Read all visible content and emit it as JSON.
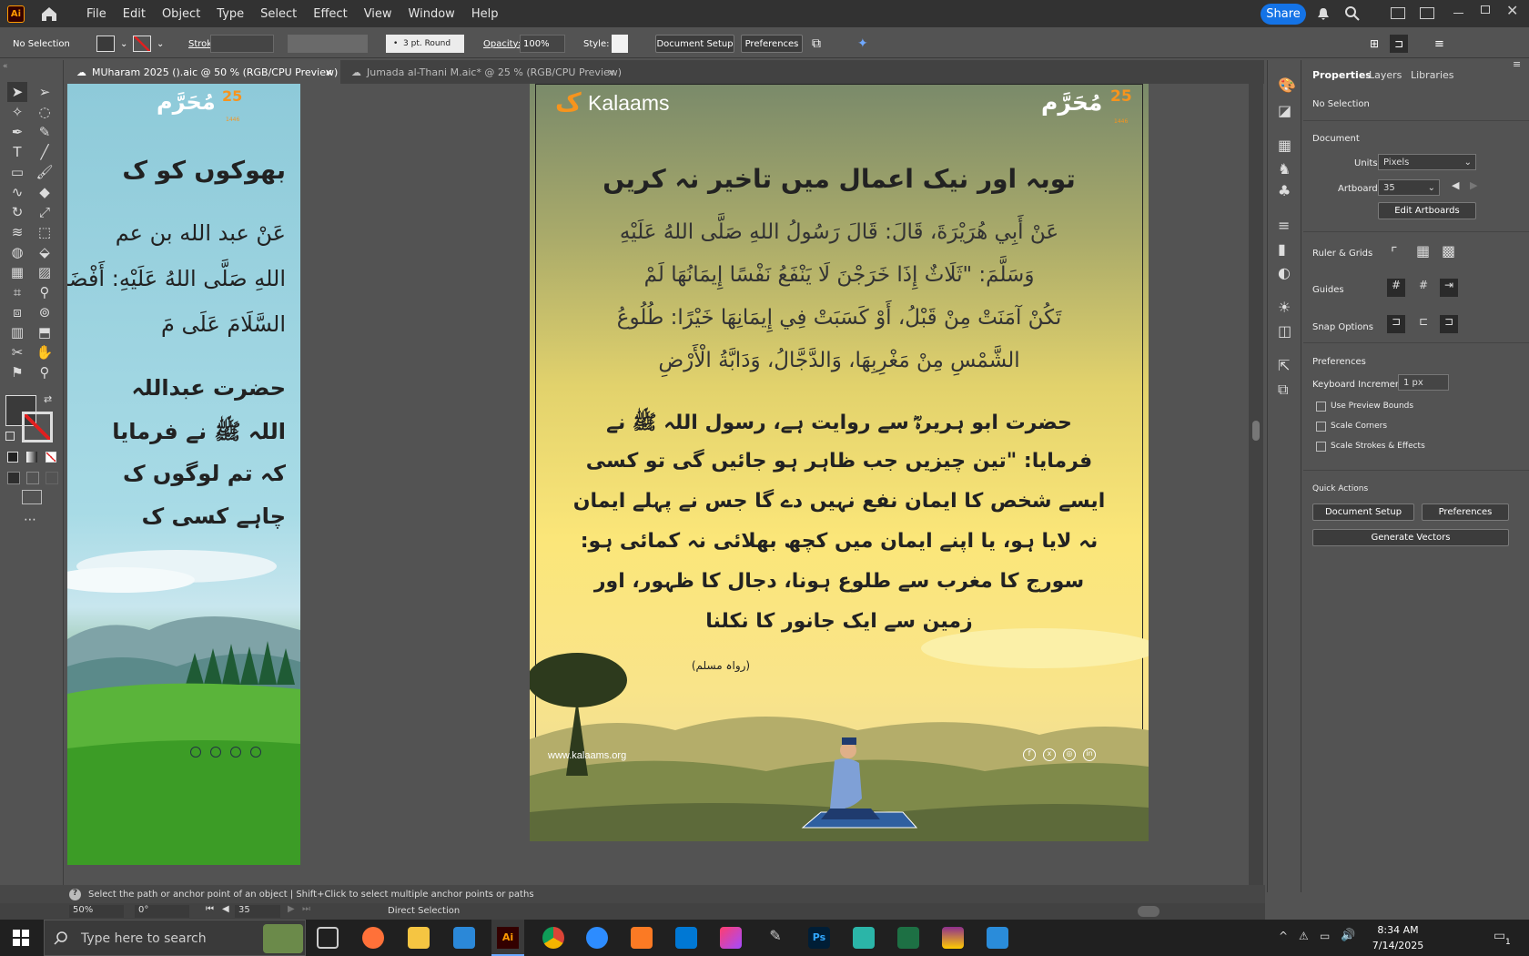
{
  "menubar": {
    "app_logo": "Ai",
    "items": [
      "File",
      "Edit",
      "Object",
      "Type",
      "Select",
      "Effect",
      "View",
      "Window",
      "Help"
    ],
    "share_label": "Share"
  },
  "control_bar": {
    "selection": "No Selection",
    "stroke_label": "Stroke:",
    "brush_value": "3 pt. Round",
    "opacity_label": "Opacity:",
    "opacity_value": "100%",
    "style_label": "Style:",
    "document_setup": "Document Setup",
    "preferences": "Preferences"
  },
  "tabs": [
    {
      "label": "MUharam 2025 ().aic @ 50 % (RGB/CPU Preview)",
      "close": "×"
    },
    {
      "label": "Jumada al-Thani M.aic* @ 25 % (RGB/CPU Preview)",
      "close": "×"
    }
  ],
  "left_artboard": {
    "badge_num": "25",
    "badge_sub": "1446",
    "heading": "بھوکوں کو ک",
    "arabic_lines": [
      "عَنْ عبد الله بن عم",
      "اللهِ صَلَّى اللهُ عَلَيْهِ: أَفْضَلُ الْ",
      "السَّلَامَ عَلَى مَ"
    ],
    "urdu_lines": [
      "حضرت عبداللہ",
      "اللہ ﷺ نے فرمایا",
      "کہ تم لوگوں ک",
      "چاہے کسی ک"
    ],
    "social_icons": [
      "facebook-icon",
      "x-icon",
      "instagram-icon",
      "linkedin-icon"
    ]
  },
  "right_artboard": {
    "brand": "Kalaams",
    "badge_num": "25",
    "badge_sub": "1446",
    "title": "توبہ اور نیک اعمال میں تاخیر نہ کریں",
    "arabic_lines": [
      "عَنْ أَبِي هُرَيْرَةَ، قَالَ: قَالَ رَسُولُ اللهِ صَلَّى اللهُ عَلَيْهِ",
      "وَسَلَّمَ: \"ثَلَاثٌ إِذَا خَرَجْنَ لَا يَنْفَعُ نَفْسًا إِيمَانُهَا لَمْ",
      "تَكُنْ آمَنَتْ مِنْ قَبْلُ، أَوْ كَسَبَتْ فِي إِيمَانِهَا خَيْرًا: طُلُوعُ",
      "الشَّمْسِ مِنْ مَغْرِبِهَا، وَالدَّجَّالُ، وَدَابَّةُ الْأَرْضِ"
    ],
    "urdu_lines": [
      "حضرت ابو ہریرہؓ سے روایت ہے، رسول اللہ ﷺ نے",
      "فرمایا: \"تین چیزیں جب ظاہر ہو جائیں گی تو کسی",
      "ایسے شخص کا ایمان نفع نہیں دے گا جس نے پہلے ایمان",
      "نہ لایا ہو، یا اپنے ایمان میں کچھ بھلائی نہ کمائی ہو:",
      "سورج کا مغرب سے طلوع ہونا، دجال کا ظہور، اور",
      "زمین سے ایک جانور کا نکلنا"
    ],
    "reference": "(رواہ مسلم)",
    "website": "www.kalaams.org"
  },
  "properties": {
    "tabs": [
      "Properties",
      "Layers",
      "Libraries"
    ],
    "selection": "No Selection",
    "document_header": "Document",
    "units_label": "Units:",
    "units_value": "Pixels",
    "artboard_label": "Artboard:",
    "artboard_value": "35",
    "edit_artboards": "Edit Artboards",
    "ruler_grids": "Ruler & Grids",
    "guides": "Guides",
    "snap_options": "Snap Options",
    "preferences_header": "Preferences",
    "keyboard_increment_label": "Keyboard Increment:",
    "keyboard_increment_value": "1 px",
    "checkboxes": [
      "Use Preview Bounds",
      "Scale Corners",
      "Scale Strokes & Effects"
    ],
    "quick_actions": "Quick Actions",
    "qa_document_setup": "Document Setup",
    "qa_preferences": "Preferences",
    "qa_generate_vectors": "Generate Vectors"
  },
  "status": {
    "hint": "Select the path or anchor point of an object  |  Shift+Click to select multiple anchor points or paths",
    "zoom": "50%",
    "rotation": "0°",
    "artboard": "35",
    "tool": "Direct Selection"
  },
  "taskbar": {
    "search_placeholder": "Type here to search",
    "time": "8:34 AM",
    "date": "7/14/2025",
    "notification_count": "1"
  }
}
